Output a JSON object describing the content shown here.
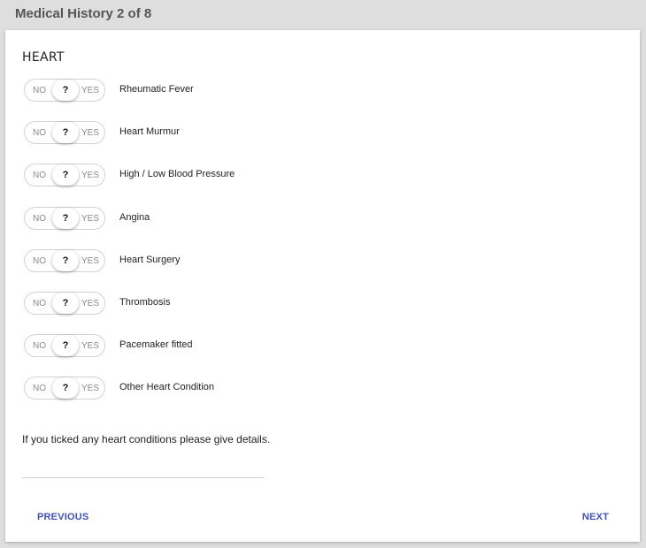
{
  "page": {
    "title": "Medical History 2 of 8"
  },
  "section": {
    "heading": "HEART"
  },
  "toggle": {
    "no_label": "NO",
    "unknown_label": "?",
    "yes_label": "YES"
  },
  "conditions": [
    {
      "label": "Rheumatic Fever",
      "value": "?"
    },
    {
      "label": "Heart Murmur",
      "value": "?"
    },
    {
      "label": "High / Low Blood Pressure",
      "value": "?"
    },
    {
      "label": "Angina",
      "value": "?"
    },
    {
      "label": "Heart Surgery",
      "value": "?"
    },
    {
      "label": "Thrombosis",
      "value": "?"
    },
    {
      "label": "Pacemaker fitted",
      "value": "?"
    },
    {
      "label": "Other Heart Condition",
      "value": "?"
    }
  ],
  "details": {
    "prompt": "If you ticked any heart conditions please give details.",
    "value": "",
    "placeholder": ""
  },
  "navigation": {
    "previous_label": "PREVIOUS",
    "next_label": "NEXT"
  },
  "colors": {
    "background": "#dedede",
    "card": "#ffffff",
    "accent": "#3f51b5",
    "title_text": "#555555"
  }
}
